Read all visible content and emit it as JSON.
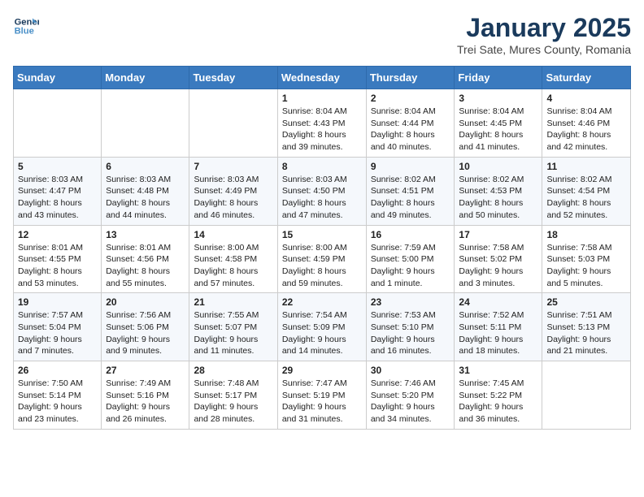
{
  "logo": {
    "line1": "General",
    "line2": "Blue"
  },
  "title": "January 2025",
  "location": "Trei Sate, Mures County, Romania",
  "days_header": [
    "Sunday",
    "Monday",
    "Tuesday",
    "Wednesday",
    "Thursday",
    "Friday",
    "Saturday"
  ],
  "weeks": [
    [
      {
        "num": "",
        "content": ""
      },
      {
        "num": "",
        "content": ""
      },
      {
        "num": "",
        "content": ""
      },
      {
        "num": "1",
        "content": "Sunrise: 8:04 AM\nSunset: 4:43 PM\nDaylight: 8 hours\nand 39 minutes."
      },
      {
        "num": "2",
        "content": "Sunrise: 8:04 AM\nSunset: 4:44 PM\nDaylight: 8 hours\nand 40 minutes."
      },
      {
        "num": "3",
        "content": "Sunrise: 8:04 AM\nSunset: 4:45 PM\nDaylight: 8 hours\nand 41 minutes."
      },
      {
        "num": "4",
        "content": "Sunrise: 8:04 AM\nSunset: 4:46 PM\nDaylight: 8 hours\nand 42 minutes."
      }
    ],
    [
      {
        "num": "5",
        "content": "Sunrise: 8:03 AM\nSunset: 4:47 PM\nDaylight: 8 hours\nand 43 minutes."
      },
      {
        "num": "6",
        "content": "Sunrise: 8:03 AM\nSunset: 4:48 PM\nDaylight: 8 hours\nand 44 minutes."
      },
      {
        "num": "7",
        "content": "Sunrise: 8:03 AM\nSunset: 4:49 PM\nDaylight: 8 hours\nand 46 minutes."
      },
      {
        "num": "8",
        "content": "Sunrise: 8:03 AM\nSunset: 4:50 PM\nDaylight: 8 hours\nand 47 minutes."
      },
      {
        "num": "9",
        "content": "Sunrise: 8:02 AM\nSunset: 4:51 PM\nDaylight: 8 hours\nand 49 minutes."
      },
      {
        "num": "10",
        "content": "Sunrise: 8:02 AM\nSunset: 4:53 PM\nDaylight: 8 hours\nand 50 minutes."
      },
      {
        "num": "11",
        "content": "Sunrise: 8:02 AM\nSunset: 4:54 PM\nDaylight: 8 hours\nand 52 minutes."
      }
    ],
    [
      {
        "num": "12",
        "content": "Sunrise: 8:01 AM\nSunset: 4:55 PM\nDaylight: 8 hours\nand 53 minutes."
      },
      {
        "num": "13",
        "content": "Sunrise: 8:01 AM\nSunset: 4:56 PM\nDaylight: 8 hours\nand 55 minutes."
      },
      {
        "num": "14",
        "content": "Sunrise: 8:00 AM\nSunset: 4:58 PM\nDaylight: 8 hours\nand 57 minutes."
      },
      {
        "num": "15",
        "content": "Sunrise: 8:00 AM\nSunset: 4:59 PM\nDaylight: 8 hours\nand 59 minutes."
      },
      {
        "num": "16",
        "content": "Sunrise: 7:59 AM\nSunset: 5:00 PM\nDaylight: 9 hours\nand 1 minute."
      },
      {
        "num": "17",
        "content": "Sunrise: 7:58 AM\nSunset: 5:02 PM\nDaylight: 9 hours\nand 3 minutes."
      },
      {
        "num": "18",
        "content": "Sunrise: 7:58 AM\nSunset: 5:03 PM\nDaylight: 9 hours\nand 5 minutes."
      }
    ],
    [
      {
        "num": "19",
        "content": "Sunrise: 7:57 AM\nSunset: 5:04 PM\nDaylight: 9 hours\nand 7 minutes."
      },
      {
        "num": "20",
        "content": "Sunrise: 7:56 AM\nSunset: 5:06 PM\nDaylight: 9 hours\nand 9 minutes."
      },
      {
        "num": "21",
        "content": "Sunrise: 7:55 AM\nSunset: 5:07 PM\nDaylight: 9 hours\nand 11 minutes."
      },
      {
        "num": "22",
        "content": "Sunrise: 7:54 AM\nSunset: 5:09 PM\nDaylight: 9 hours\nand 14 minutes."
      },
      {
        "num": "23",
        "content": "Sunrise: 7:53 AM\nSunset: 5:10 PM\nDaylight: 9 hours\nand 16 minutes."
      },
      {
        "num": "24",
        "content": "Sunrise: 7:52 AM\nSunset: 5:11 PM\nDaylight: 9 hours\nand 18 minutes."
      },
      {
        "num": "25",
        "content": "Sunrise: 7:51 AM\nSunset: 5:13 PM\nDaylight: 9 hours\nand 21 minutes."
      }
    ],
    [
      {
        "num": "26",
        "content": "Sunrise: 7:50 AM\nSunset: 5:14 PM\nDaylight: 9 hours\nand 23 minutes."
      },
      {
        "num": "27",
        "content": "Sunrise: 7:49 AM\nSunset: 5:16 PM\nDaylight: 9 hours\nand 26 minutes."
      },
      {
        "num": "28",
        "content": "Sunrise: 7:48 AM\nSunset: 5:17 PM\nDaylight: 9 hours\nand 28 minutes."
      },
      {
        "num": "29",
        "content": "Sunrise: 7:47 AM\nSunset: 5:19 PM\nDaylight: 9 hours\nand 31 minutes."
      },
      {
        "num": "30",
        "content": "Sunrise: 7:46 AM\nSunset: 5:20 PM\nDaylight: 9 hours\nand 34 minutes."
      },
      {
        "num": "31",
        "content": "Sunrise: 7:45 AM\nSunset: 5:22 PM\nDaylight: 9 hours\nand 36 minutes."
      },
      {
        "num": "",
        "content": ""
      }
    ]
  ]
}
